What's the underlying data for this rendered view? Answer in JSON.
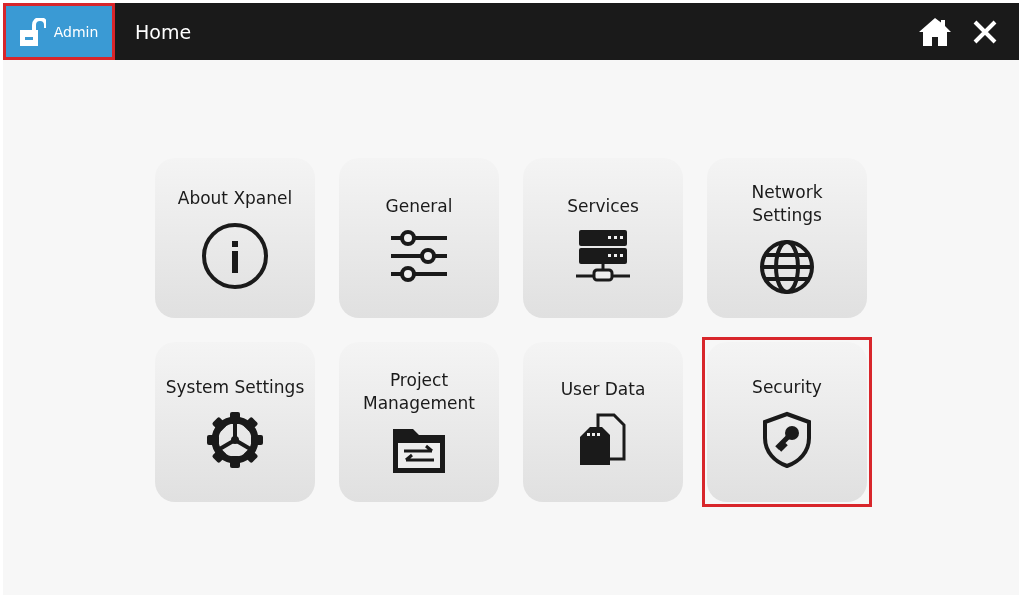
{
  "top_bar": {
    "user_button": {
      "label": "Admin",
      "highlighted": true
    },
    "title": "Home"
  },
  "tiles": [
    {
      "label": "About Xpanel",
      "kind": "info",
      "highlighted": false
    },
    {
      "label": "General",
      "kind": "sliders",
      "highlighted": false
    },
    {
      "label": "Services",
      "kind": "server",
      "highlighted": false
    },
    {
      "label": "Network Settings",
      "kind": "globe",
      "highlighted": false
    },
    {
      "label": "System Settings",
      "kind": "gear",
      "highlighted": false
    },
    {
      "label": "Project Management",
      "kind": "folder",
      "highlighted": false
    },
    {
      "label": "User Data",
      "kind": "files",
      "highlighted": false
    },
    {
      "label": "Security",
      "kind": "shield",
      "highlighted": true
    }
  ]
}
